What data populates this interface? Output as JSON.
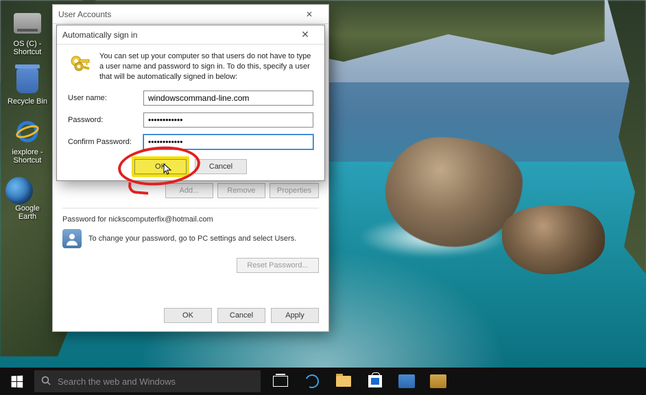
{
  "desktop": {
    "icons": [
      {
        "label": "OS (C) - Shortcut"
      },
      {
        "label": "Recycle Bin"
      },
      {
        "label": "iexplore - Shortcut"
      },
      {
        "label": "Google Earth"
      }
    ]
  },
  "dialogParent": {
    "title": "User Accounts",
    "buttons": {
      "add": "Add...",
      "remove": "Remove",
      "properties": "Properties"
    },
    "passwordSection": {
      "heading": "Password for nickscomputerfix@hotmail.com",
      "hint": "To change your password, go to PC settings and select Users.",
      "resetBtn": "Reset Password..."
    },
    "footer": {
      "ok": "OK",
      "cancel": "Cancel",
      "apply": "Apply"
    }
  },
  "dialogChild": {
    "title": "Automatically sign in",
    "intro": "You can set up your computer so that users do not have to type a user name and password to sign in. To do this, specify a user that will be automatically signed in below:",
    "labels": {
      "username": "User name:",
      "password": "Password:",
      "confirm": "Confirm Password:"
    },
    "values": {
      "username": "windowscommand-line.com",
      "password": "••••••••••••",
      "confirm": "••••••••••••"
    },
    "buttons": {
      "ok": "OK",
      "cancel": "Cancel"
    }
  },
  "taskbar": {
    "searchPlaceholder": "Search the web and Windows"
  }
}
